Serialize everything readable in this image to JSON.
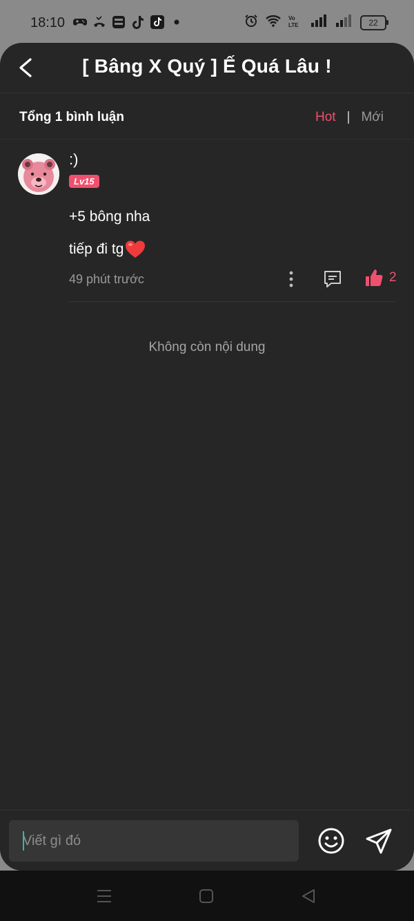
{
  "status_bar": {
    "time": "18:10",
    "left_icons": [
      "game-controller-icon",
      "missed-call-icon",
      "bao-moi-icon",
      "tiktok-icon",
      "tiktok-icon",
      "dot-icon"
    ],
    "right_icons": [
      "alarm-icon",
      "wifi-icon",
      "volte-icon",
      "signal-icon",
      "signal-icon"
    ],
    "battery": "22"
  },
  "header": {
    "title": "[ Bâng X Quý ] Ế Quá Lâu !"
  },
  "subbar": {
    "total_label": "Tổng 1 bình luận",
    "sort_hot": "Hot",
    "sort_sep": "|",
    "sort_new": "Mới"
  },
  "comment": {
    "username": ":)",
    "level": "Lv15",
    "line1": "+5 bông nha",
    "line2": "tiếp đi tg",
    "time": "49 phút trước",
    "likes": "2"
  },
  "list_end_text": "Không còn nội dung",
  "input": {
    "placeholder": "Viết gì đó"
  },
  "colors": {
    "accent": "#f0506e",
    "background": "#262626",
    "input_bg": "#363636"
  }
}
